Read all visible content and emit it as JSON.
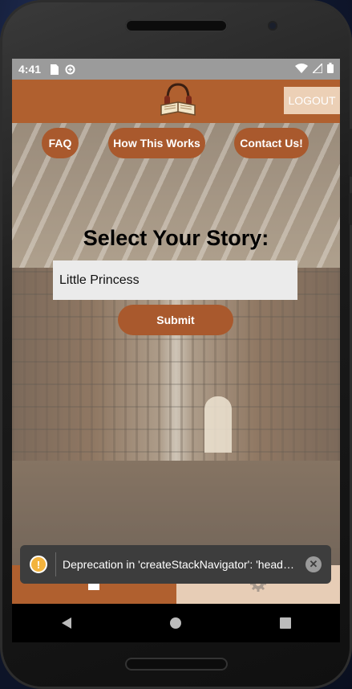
{
  "status_bar": {
    "time": "4:41",
    "left_icons": [
      "sd-card-icon",
      "data-saver-icon"
    ],
    "right_icons": [
      "wifi-icon",
      "signal-icon",
      "battery-icon"
    ]
  },
  "header": {
    "logo_icon": "book-headphones-logo",
    "logout_label": "LOGOUT"
  },
  "nav_pills": [
    {
      "label": "FAQ"
    },
    {
      "label": "How This Works"
    },
    {
      "label": "Contact Us!"
    }
  ],
  "main": {
    "title": "Select Your Story:",
    "story_input_value": "Little Princess",
    "submit_label": "Submit"
  },
  "tab_bar": {
    "tabs": [
      {
        "icon": "home-icon",
        "active": true
      },
      {
        "icon": "gear-icon",
        "active": false
      }
    ]
  },
  "toast": {
    "icon": "warning-icon",
    "message": "Deprecation in 'createStackNavigator': 'header...",
    "close_icon": "close-icon"
  },
  "android_nav": {
    "buttons": [
      "back-icon",
      "home-circle-icon",
      "recents-icon"
    ]
  },
  "colors": {
    "brand": "#b0602f",
    "pill": "#a9592d",
    "tab_inactive": "#e7cdb6",
    "toast_bg": "#3d3d3d"
  }
}
